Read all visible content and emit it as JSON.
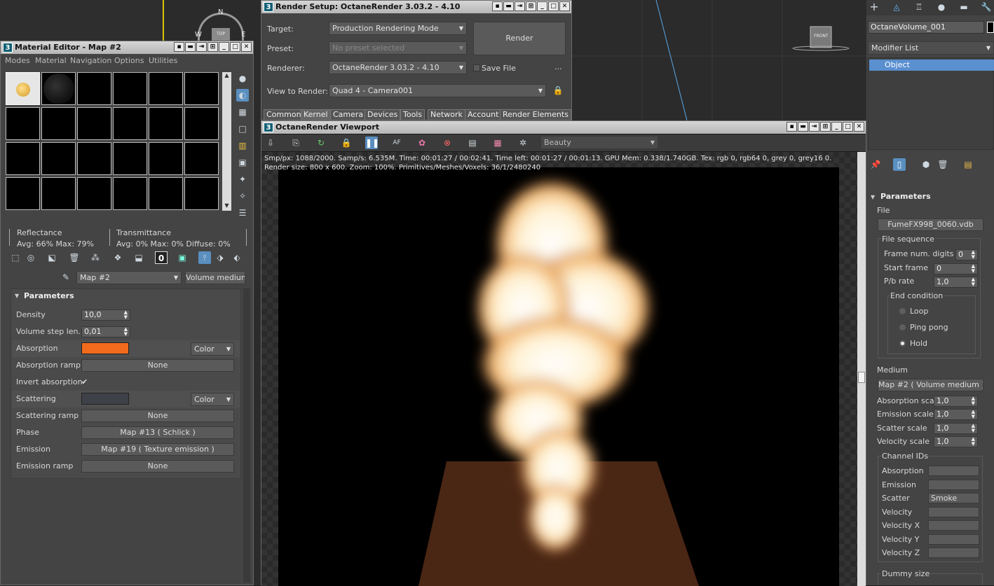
{
  "material_editor": {
    "title": "Material Editor - Map #2",
    "menu": [
      "Modes",
      "Material",
      "Navigation",
      "Options",
      "Utilities"
    ],
    "reflectance": {
      "label": "Reflectance",
      "values": "Avg:  66% Max:  79%"
    },
    "transmittance": {
      "label": "Transmittance",
      "values": "Avg:   0% Max:   0%  Diffuse:   0%"
    },
    "map_name": "Map #2",
    "map_type": "Volume medium",
    "params_title": "Parameters",
    "params": [
      {
        "label": "Density",
        "value": "10,0"
      },
      {
        "label": "Volume step len...",
        "value": "0,01"
      }
    ],
    "absorption_label": "Absorption",
    "absorption_color": "#f26a1b",
    "absorption_mode": "Color",
    "absorption_ramp_label": "Absorption ramp",
    "absorption_ramp_value": "None",
    "invert_label": "Invert absorption",
    "invert_check": "✔",
    "scattering_label": "Scattering",
    "scattering_color": "#3e4147",
    "scattering_mode": "Color",
    "scattering_ramp_label": "Scattering ramp",
    "scattering_ramp_value": "None",
    "phase_label": "Phase",
    "phase_value": "Map #13  ( Schlick )",
    "emission_label": "Emission",
    "emission_value": "Map #19  ( Texture emission )",
    "emission_ramp_label": "Emission ramp",
    "emission_ramp_value": "None"
  },
  "render_setup": {
    "title": "Render Setup: OctaneRender 3.03.2 - 4.10",
    "target_label": "Target:",
    "target_value": "Production Rendering Mode",
    "preset_label": "Preset:",
    "preset_value": "No preset selected",
    "renderer_label": "Renderer:",
    "renderer_value": "OctaneRender 3.03.2 - 4.10",
    "save_file": "Save File",
    "more": "...",
    "render_button": "Render",
    "view_label": "View to Render:",
    "view_value": "Quad 4 - Camera001",
    "tabs": [
      "Common",
      "Kernel",
      "Camera",
      "Devices",
      "Tools",
      "Network",
      "Account",
      "Render Elements"
    ]
  },
  "viewport": {
    "title": "OctaneRender Viewport",
    "pass": "Beauty",
    "stats_line1": "Smp/px:  1088/2000.   Samp/s: 6.535M.   Time: 00:01:27 / 00:02:41.   Time left: 00:01:27 / 00:01:13.   GPU Mem: 0.338/1.740GB.   Tex: rgb 0, rgb64 0, grey 0, grey16 0.",
    "stats_line2": "Render size: 800 x 600.   Zoom: 100%.   Primitives/Meshes/Voxels: 36/1/2480240"
  },
  "viewcube_top": {
    "compass_n": "N",
    "compass_w": "W",
    "compass_e": "E",
    "face": "TOP"
  },
  "viewcube_front": "FRONT",
  "command_panel": {
    "object_name": "OctaneVolume_001",
    "modifier_list": "Modifier List",
    "stack_item": "Object",
    "params_title": "Parameters",
    "file_label": "File",
    "file_value": "FumeFX998_0060.vdb",
    "file_sequence": "File sequence",
    "seq": [
      {
        "label": "Frame num. digits",
        "value": "0"
      },
      {
        "label": "Start frame",
        "value": "0"
      },
      {
        "label": "P/b rate",
        "value": "1,0"
      }
    ],
    "end_condition": "End condition",
    "end_options": [
      "Loop",
      "Ping pong",
      "Hold"
    ],
    "medium_label": "Medium",
    "medium_value": "Map #2  ( Volume medium )",
    "scales": [
      {
        "label": "Absorption scale",
        "value": "1,0"
      },
      {
        "label": "Emission scale",
        "value": "1,0"
      },
      {
        "label": "Scatter scale",
        "value": "1,0"
      },
      {
        "label": "Velocity scale",
        "value": "1,0"
      }
    ],
    "channel_ids_label": "Channel IDs",
    "channels": [
      {
        "label": "Absorption",
        "value": ""
      },
      {
        "label": "Emission",
        "value": ""
      },
      {
        "label": "Scatter",
        "value": "Smoke"
      },
      {
        "label": "Velocity",
        "value": ""
      },
      {
        "label": "Velocity X",
        "value": ""
      },
      {
        "label": "Velocity Y",
        "value": ""
      },
      {
        "label": "Velocity Z",
        "value": ""
      }
    ],
    "dummy_size": "Dummy size"
  }
}
